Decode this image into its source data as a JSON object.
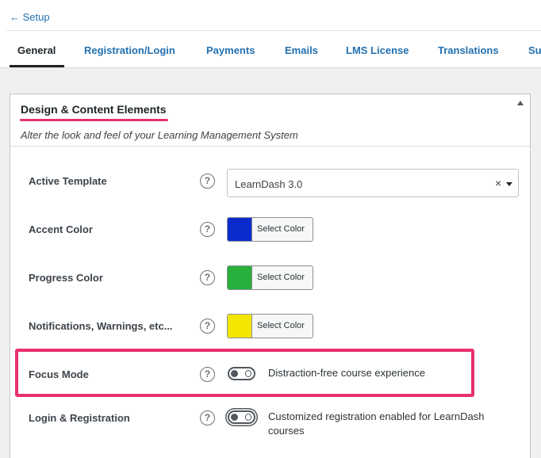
{
  "nav": {
    "back_label": "← Setup",
    "tabs": [
      {
        "label": "General",
        "active": true
      },
      {
        "label": "Registration/Login",
        "active": false
      },
      {
        "label": "Payments",
        "active": false
      },
      {
        "label": "Emails",
        "active": false
      },
      {
        "label": "LMS License",
        "active": false
      },
      {
        "label": "Translations",
        "active": false
      },
      {
        "label": "Su",
        "active": false
      }
    ]
  },
  "panel": {
    "title": "Design & Content Elements",
    "subtitle": "Alter the look and feel of your Learning Management System",
    "help_symbol": "?",
    "rows": {
      "active_template": {
        "label": "Active Template",
        "value": "LearnDash 3.0",
        "clear_symbol": "×"
      },
      "accent_color": {
        "label": "Accent Color",
        "button_label": "Select Color",
        "color": "#0b2bcc"
      },
      "progress_color": {
        "label": "Progress Color",
        "button_label": "Select Color",
        "color": "#27b03c"
      },
      "notifications": {
        "label": "Notifications, Warnings, etc...",
        "button_label": "Select Color",
        "color": "#f2e600"
      },
      "focus_mode": {
        "label": "Focus Mode",
        "description": "Distraction-free course experience",
        "enabled": false
      },
      "login_registration": {
        "label": "Login & Registration",
        "description_line1": "Customized registration enabled for LearnDash",
        "description_line2": "courses",
        "enabled": false
      }
    }
  },
  "colors": {
    "link": "#2271b1",
    "highlight": "#e8306d"
  }
}
